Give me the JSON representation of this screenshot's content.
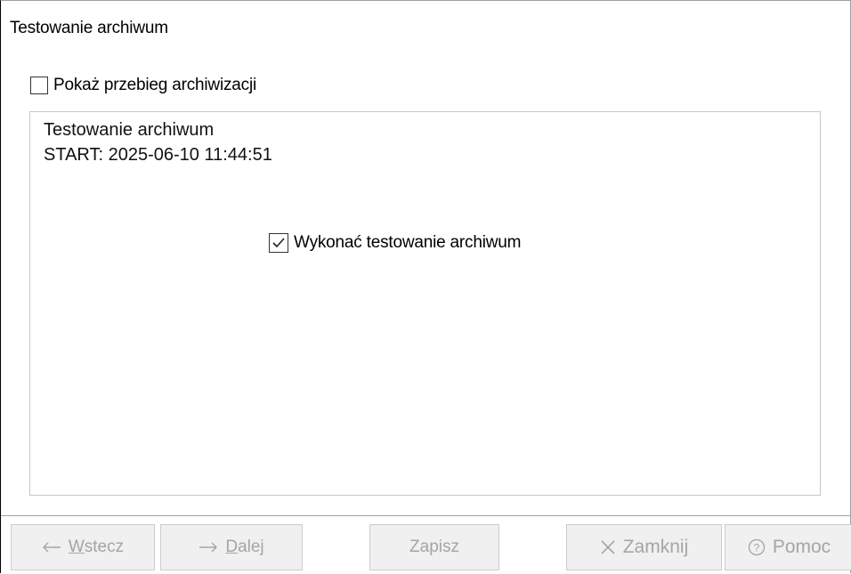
{
  "dialog": {
    "title": "Testowanie archiwum"
  },
  "show_progress": {
    "label": "Pokaż przebieg archiwizacji",
    "checked": false
  },
  "log": {
    "lines": [
      "Testowanie archiwum",
      "START: 2025-06-10 11:44:51"
    ]
  },
  "perform_test": {
    "label": "Wykonać testowanie archiwum",
    "checked": true
  },
  "buttons": {
    "back": {
      "mnemonic": "W",
      "rest": "stecz",
      "icon": "arrow-left-icon",
      "enabled": false
    },
    "next": {
      "mnemonic": "D",
      "rest": "alej",
      "icon": "arrow-right-icon",
      "enabled": false
    },
    "save": {
      "label": "Zapisz",
      "enabled": false
    },
    "close": {
      "label": "Zamknij",
      "icon": "close-x-icon",
      "enabled": false
    },
    "help": {
      "label": "Pomoc",
      "icon": "help-circle-icon",
      "enabled": false
    }
  },
  "colors": {
    "disabled_text": "#a5a5a5",
    "button_face": "#f0f0f0",
    "panel_border": "#c7c7c7"
  }
}
